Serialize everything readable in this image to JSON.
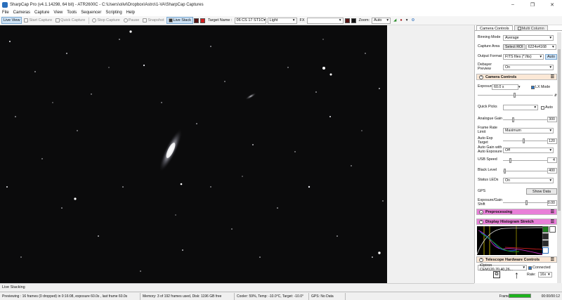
{
  "window": {
    "title": "SharpCap Pro (v4.1.14298, 64 bit) - ATR2600C - C:\\Users\\olivi\\Dropbox\\Astro\\1-VA\\SharpCap Captures",
    "controls": [
      "–",
      "❐",
      "✕"
    ]
  },
  "menu": [
    "File",
    "Cameras",
    "Capture",
    "View",
    "Tools",
    "Sequencer",
    "Scripting",
    "Help"
  ],
  "toolbar": {
    "live_view": "Live View",
    "start_capture": "Start Capture",
    "quick_capture": "Quick Capture",
    "stop_capture": "Stop Capture",
    "pause": "Pause",
    "snapshot": "Snapshot",
    "live_stack": "Live Stack",
    "target_name_label": "Target Name :",
    "target_name_value": "06 CS 17 ST1C",
    "profile_value": "Light",
    "fx_label": "FX",
    "fx_value": "",
    "zoom_label": "Zoom:",
    "zoom_value": "Auto"
  },
  "colors": {
    "swatch_dark_red": "#5a1414",
    "swatch_red": "#d32020",
    "swatch_black": "#111111",
    "camera_controls_header": "#fbe8d6",
    "preprocessing_header": "#e87fd8",
    "histogram_header": "#e87fd8",
    "telescope_header": "#fbe8d6",
    "frame_progress": "#1db31d"
  },
  "panel": {
    "tab_camera_controls": "Camera Controls",
    "tab_multi_column": "Multi Column",
    "binning_mode": {
      "label": "Binning Mode",
      "value": "Average"
    },
    "capture_area": {
      "label": "Capture Area",
      "button": "Select ROI",
      "value": "6224x4168"
    },
    "output_format": {
      "label": "Output Format",
      "value": "FITS files (*.fits)",
      "auto": "Auto"
    },
    "debayer_preview": {
      "label": "Debayer Preview",
      "value": "On"
    },
    "camera_controls_section": "Camera Controls",
    "exposure": {
      "label": "Exposure",
      "value": "60.0 s",
      "lx_mode": "LX Mode"
    },
    "quick_picks": {
      "label": "Quick Picks",
      "auto": "Auto"
    },
    "analogue_gain": {
      "label": "Analogue Gain",
      "value": "300"
    },
    "frame_rate_limit": {
      "label": "Frame Rate Limit",
      "value": "Maximum"
    },
    "auto_exp_target": {
      "label": "Auto Exp Target",
      "value": "120"
    },
    "auto_gain": {
      "label": "Auto Gain with Auto Exposure",
      "value": "Off"
    },
    "usb_speed": {
      "label": "USB Speed",
      "value": "4"
    },
    "black_level": {
      "label": "Black Level",
      "value": "400"
    },
    "status_leds": {
      "label": "Status LEDs",
      "value": "On"
    },
    "gps": {
      "label": "GPS",
      "button": "Show Data"
    },
    "exposure_gain_shift": {
      "label": "Exposure/Gain Shift",
      "value": "0.00"
    },
    "preprocessing_section": "Preprocessing",
    "histogram_section": "Display Histogram Stretch",
    "telescope_section": "Telescope Hardware Controls",
    "telescope": {
      "mount": "iOptron CEM120,70,40,26...",
      "connected": "Connected",
      "rate_label": "Rate:",
      "rate_value": "16x"
    }
  },
  "bottom_tab": "Live Stacking",
  "status": {
    "previewing": "Previewing : 16 frames (0 dropped) in 0:16:08, exposure 60.0s , last frame 60.0s",
    "memory": "Memory: 3 of 192 frames used, Disk: 1196 GB free",
    "cooler": "Cooler: 59%, Temp: -10.0°C, Target: -10.0°",
    "gps": "GPS: No Data",
    "frame_label": "Frame:",
    "frame_progress": 1.0,
    "time": "00:00/00:12"
  }
}
